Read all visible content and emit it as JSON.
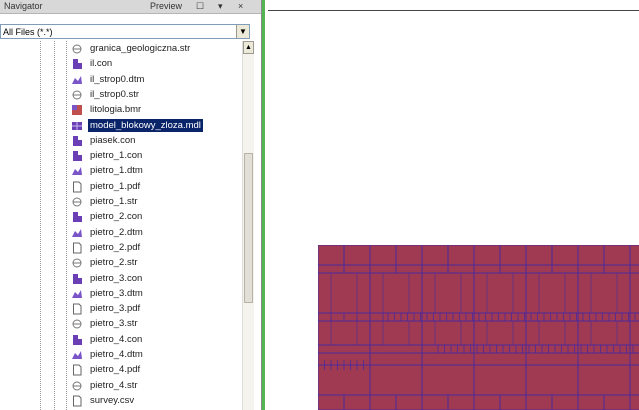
{
  "navigator": {
    "title": "Navigator",
    "preview_label": "Preview",
    "filter": {
      "value": "All Files (*.*)"
    },
    "files": [
      {
        "name": "granica_geologiczna.str",
        "icon": "str-icon",
        "selected": false
      },
      {
        "name": "il.con",
        "icon": "con-icon",
        "selected": false
      },
      {
        "name": "il_strop0.dtm",
        "icon": "dtm-icon",
        "selected": false
      },
      {
        "name": "il_strop0.str",
        "icon": "str-icon",
        "selected": false
      },
      {
        "name": "litologia.bmr",
        "icon": "bmr-icon",
        "selected": false
      },
      {
        "name": "model_blokowy_zloza.mdl",
        "icon": "mdl-icon",
        "selected": true
      },
      {
        "name": "piasek.con",
        "icon": "con-icon",
        "selected": false
      },
      {
        "name": "pietro_1.con",
        "icon": "con-icon",
        "selected": false
      },
      {
        "name": "pietro_1.dtm",
        "icon": "dtm-icon",
        "selected": false
      },
      {
        "name": "pietro_1.pdf",
        "icon": "pdf-icon",
        "selected": false
      },
      {
        "name": "pietro_1.str",
        "icon": "str-icon",
        "selected": false
      },
      {
        "name": "pietro_2.con",
        "icon": "con-icon",
        "selected": false
      },
      {
        "name": "pietro_2.dtm",
        "icon": "dtm-icon",
        "selected": false
      },
      {
        "name": "pietro_2.pdf",
        "icon": "pdf-icon",
        "selected": false
      },
      {
        "name": "pietro_2.str",
        "icon": "str-icon",
        "selected": false
      },
      {
        "name": "pietro_3.con",
        "icon": "con-icon",
        "selected": false
      },
      {
        "name": "pietro_3.dtm",
        "icon": "dtm-icon",
        "selected": false
      },
      {
        "name": "pietro_3.pdf",
        "icon": "pdf-icon",
        "selected": false
      },
      {
        "name": "pietro_3.str",
        "icon": "str-icon",
        "selected": false
      },
      {
        "name": "pietro_4.con",
        "icon": "con-icon",
        "selected": false
      },
      {
        "name": "pietro_4.dtm",
        "icon": "dtm-icon",
        "selected": false
      },
      {
        "name": "pietro_4.pdf",
        "icon": "pdf-icon",
        "selected": false
      },
      {
        "name": "pietro_4.str",
        "icon": "str-icon",
        "selected": false
      },
      {
        "name": "survey.csv",
        "icon": "csv-icon",
        "selected": false
      }
    ]
  },
  "colors": {
    "selection": "#0a246a",
    "panel_divider": "#52b552",
    "model_fill": "#a03a52",
    "model_grid": "#4a2a9a",
    "con_icon": "#6a3fb5",
    "dtm_icon": "#7a55c8"
  }
}
